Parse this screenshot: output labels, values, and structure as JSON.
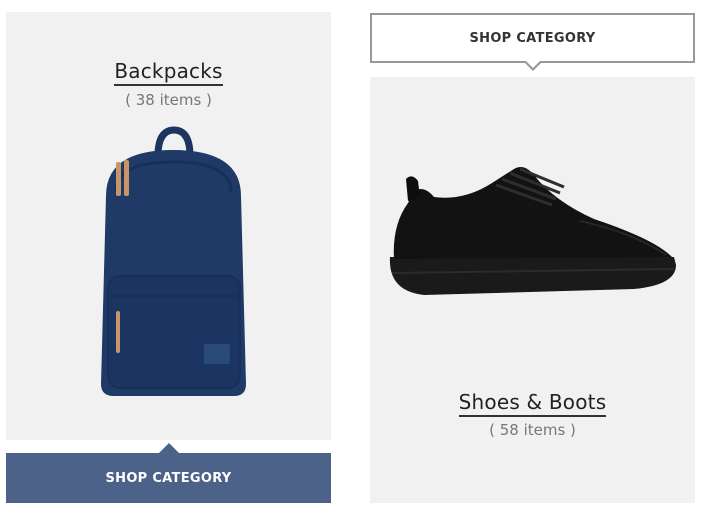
{
  "categories": [
    {
      "title": "Backpacks",
      "count": "( 38 items )",
      "button_label": "SHOP CATEGORY",
      "image_icon": "backpack-image",
      "button_color": "#4d6289"
    },
    {
      "title": "Shoes & Boots",
      "count": "( 58 items )",
      "button_label": "SHOP CATEGORY",
      "image_icon": "sneaker-image",
      "button_color": "#ffffff"
    }
  ],
  "colors": {
    "card_background": "#f1f1f1",
    "accent": "#4d6289",
    "backpack": "#1f3a66",
    "shoe": "#111111"
  }
}
